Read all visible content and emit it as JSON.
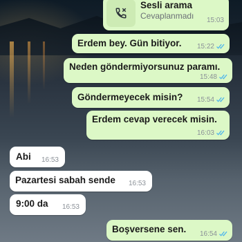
{
  "call": {
    "title": "Sesli arama",
    "subtitle": "Cevaplanmadı",
    "time": "15:03",
    "icon": "missed-call-phone-icon"
  },
  "messages": [
    {
      "direction": "outgoing",
      "text": "Erdem bey. Gün bitiyor.",
      "time": "15:22",
      "status": "read"
    },
    {
      "direction": "outgoing",
      "text": "Neden göndermiyorsunuz paramı.",
      "time": "15:48",
      "status": "read"
    },
    {
      "direction": "outgoing",
      "text": "Göndermeyecek misin?",
      "time": "15:54",
      "status": "read"
    },
    {
      "direction": "outgoing",
      "text": "Erdem cevap verecek misin.",
      "time": "16:03",
      "status": "read"
    },
    {
      "direction": "incoming",
      "text": "Abi",
      "time": "16:53"
    },
    {
      "direction": "incoming",
      "text": "Pazartesi sabah sende",
      "time": "16:53"
    },
    {
      "direction": "incoming",
      "text": "9:00 da",
      "time": "16:53"
    },
    {
      "direction": "outgoing",
      "text": "Boşversene sen.",
      "time": "16:54",
      "status": "read"
    }
  ],
  "colors": {
    "outgoing_bubble": "#dcf8c6",
    "incoming_bubble": "#ffffff",
    "read_ticks": "#4fb6ec",
    "timestamp": "#8a9097"
  }
}
